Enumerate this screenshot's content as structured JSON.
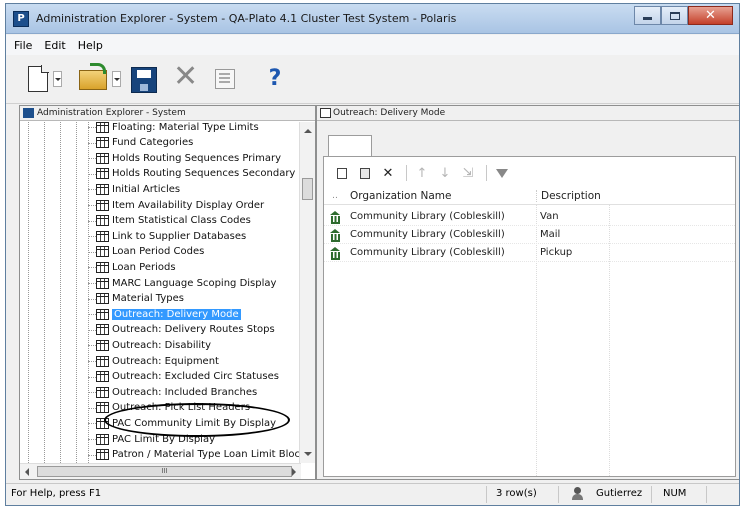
{
  "window": {
    "app_icon_letter": "P",
    "title": "Administration Explorer - System - QA-Plato 4.1 Cluster Test System - Polaris"
  },
  "menu": [
    "File",
    "Edit",
    "Help"
  ],
  "toolbar": {
    "icons": [
      "new-document-icon",
      "open-folder-icon",
      "save-icon",
      "delete-icon",
      "properties-icon",
      "help-icon"
    ]
  },
  "left_panel": {
    "header": "Administration Explorer - System",
    "items": [
      {
        "label": "Floating: Material Type Limits"
      },
      {
        "label": "Fund Categories"
      },
      {
        "label": "Holds Routing Sequences Primary"
      },
      {
        "label": "Holds Routing Sequences Secondary"
      },
      {
        "label": "Initial Articles"
      },
      {
        "label": "Item Availability Display Order"
      },
      {
        "label": "Item Statistical Class Codes"
      },
      {
        "label": "Link to Supplier Databases"
      },
      {
        "label": "Loan Period Codes"
      },
      {
        "label": "Loan Periods"
      },
      {
        "label": "MARC Language Scoping Display"
      },
      {
        "label": "Material Types"
      },
      {
        "label": "Outreach: Delivery Mode",
        "selected": true
      },
      {
        "label": "Outreach: Delivery Routes Stops"
      },
      {
        "label": "Outreach: Disability"
      },
      {
        "label": "Outreach: Equipment"
      },
      {
        "label": "Outreach: Excluded Circ Statuses"
      },
      {
        "label": "Outreach: Included Branches"
      },
      {
        "label": "Outreach: Pick List Headers"
      },
      {
        "label": "PAC Community Limit By Display"
      },
      {
        "label": "PAC Limit By Display"
      },
      {
        "label": "Patron / Material Type Loan Limit Blocks"
      }
    ],
    "hscroll_thumb_label": "III"
  },
  "right_panel": {
    "header": "Outreach: Delivery Mode",
    "grid": {
      "header_marker": "..",
      "columns": [
        "Organization Name",
        "Description"
      ],
      "rows": [
        {
          "org": "Community Library (Cobleskill)",
          "desc": "Van"
        },
        {
          "org": "Community Library (Cobleskill)",
          "desc": "Mail"
        },
        {
          "org": "Community Library (Cobleskill)",
          "desc": "Pickup"
        }
      ]
    }
  },
  "status": {
    "help": "For Help, press F1",
    "rows": "3 row(s)",
    "user": "Gutierrez",
    "mode": "NUM"
  },
  "colors": {
    "selection": "#3399ff",
    "title_bar": "#b9cfea",
    "close_button": "#c4402a"
  }
}
